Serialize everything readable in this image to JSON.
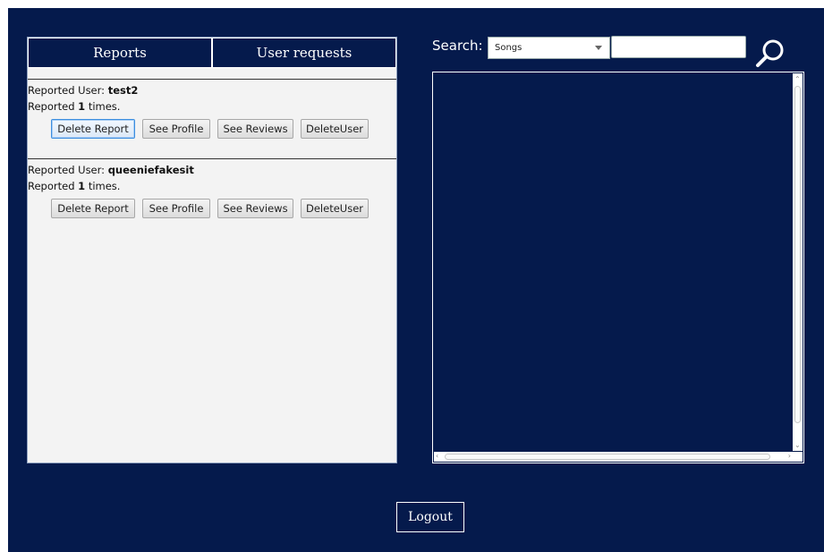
{
  "tabs": [
    {
      "label": "Reports"
    },
    {
      "label": "User requests"
    }
  ],
  "reports": [
    {
      "prefix": "Reported User: ",
      "user": "test2",
      "count_prefix": "Reported ",
      "count": "1",
      "count_suffix": " times."
    },
    {
      "prefix": "Reported User: ",
      "user": "queeniefakesit",
      "count_prefix": "Reported ",
      "count": "1",
      "count_suffix": " times."
    }
  ],
  "report_actions": {
    "delete_report": "Delete Report",
    "see_profile": "See Profile",
    "see_reviews": "See Reviews",
    "delete_user": "DeleteUser"
  },
  "search": {
    "label": "Search:",
    "category": "Songs",
    "value": ""
  },
  "icons": {
    "search": "magnifier-icon"
  },
  "logout_label": "Logout",
  "colors": {
    "background": "#051a4c",
    "panel": "#f3f3f3",
    "accent_focus": "#3c8ee0"
  }
}
